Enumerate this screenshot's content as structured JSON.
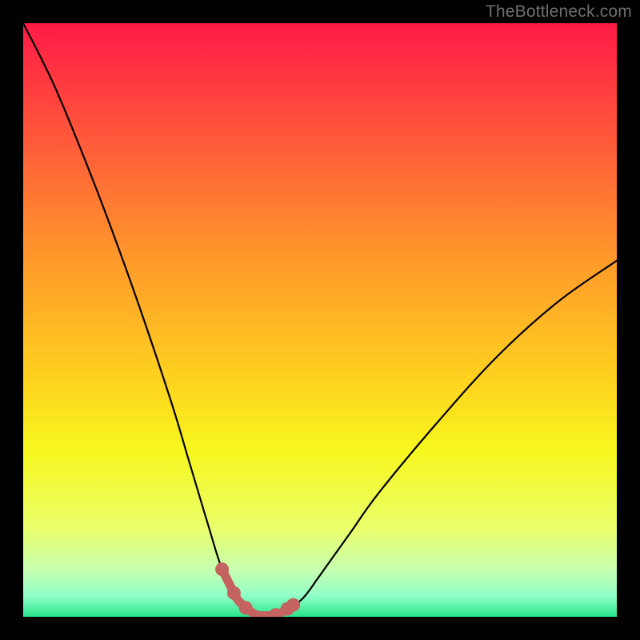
{
  "watermark": "TheBottleneck.com",
  "chart_data": {
    "type": "line",
    "title": "",
    "xlabel": "",
    "ylabel": "",
    "ylim": [
      0,
      100
    ],
    "xlim": [
      0,
      100
    ],
    "note": "V-shaped bottleneck curve; minimum near x≈38–45% of width where bottleneck≈0%. Left branch rises to ~100%, right branch rises to ~60%.",
    "series": [
      {
        "name": "bottleneck-curve",
        "x": [
          0,
          5,
          10,
          15,
          20,
          25,
          28,
          31,
          33.5,
          36,
          38,
          40,
          42,
          44,
          47,
          50,
          55,
          60,
          70,
          80,
          90,
          100
        ],
        "values": [
          100,
          90,
          78,
          65,
          51,
          36,
          26,
          16,
          8,
          3,
          1,
          0,
          0,
          1,
          3,
          7,
          14,
          21,
          33,
          44,
          53,
          60
        ]
      }
    ],
    "gradient_stops": [
      {
        "offset": 0.0,
        "color": "#ff1a46"
      },
      {
        "offset": 0.2,
        "color": "#ff5a3a"
      },
      {
        "offset": 0.4,
        "color": "#ff9a2a"
      },
      {
        "offset": 0.6,
        "color": "#ffd21f"
      },
      {
        "offset": 0.72,
        "color": "#f7f71e"
      },
      {
        "offset": 0.85,
        "color": "#eaff6a"
      },
      {
        "offset": 0.92,
        "color": "#c8ffb0"
      },
      {
        "offset": 0.965,
        "color": "#90ffc8"
      },
      {
        "offset": 1.0,
        "color": "#28e58a"
      }
    ],
    "marker_points_x_pct": [
      33.5,
      35.5,
      37.5,
      42.5,
      44.5,
      45.5
    ],
    "flat_bottom_x_pct": [
      36,
      44
    ]
  }
}
